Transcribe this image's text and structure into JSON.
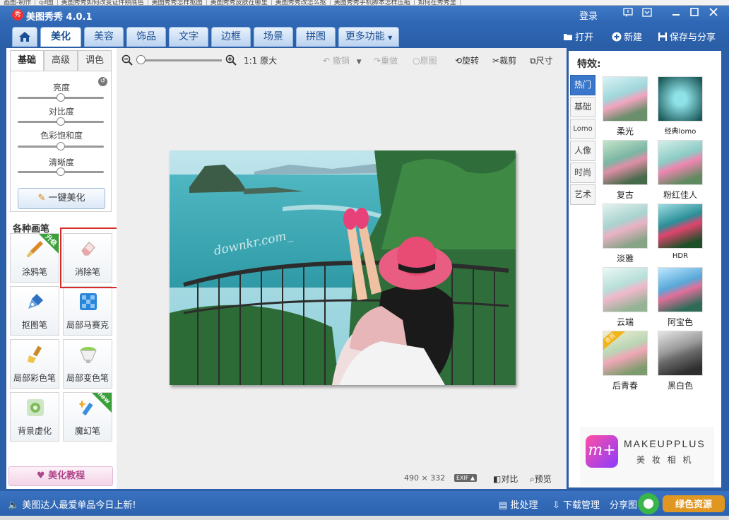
{
  "browser_tabs": [
    "画图-制作",
    "gif图",
    "美图秀秀如何改变证件照底色",
    "美图秀秀怎样抠图",
    "美图秀秀皮肤在哪里",
    "美图秀秀改怎么抠",
    "美图秀秀手机脚本怎样压缩",
    "如何在秀秀里"
  ],
  "app": {
    "title": "美图秀秀 4.0.1",
    "logo": "秀",
    "login": "登录"
  },
  "nav_tabs": [
    "美化",
    "美容",
    "饰品",
    "文字",
    "边框",
    "场景",
    "拼图",
    "更多功能"
  ],
  "actions": {
    "open": "打开",
    "new": "新建",
    "save_share": "保存与分享"
  },
  "left": {
    "subtabs": [
      "基础",
      "高级",
      "调色"
    ],
    "sliders": [
      {
        "label": "亮度",
        "value": 0.5
      },
      {
        "label": "对比度",
        "value": 0.5
      },
      {
        "label": "色彩饱和度",
        "value": 0.5
      },
      {
        "label": "清晰度",
        "value": 0.5
      }
    ],
    "one_click": "一键美化",
    "brushes_title": "各种画笔",
    "tools": [
      {
        "label": "涂鸦笔",
        "badge": "升级"
      },
      {
        "label": "消除笔"
      },
      {
        "label": "抠图笔"
      },
      {
        "label": "局部马赛克"
      },
      {
        "label": "局部彩色笔"
      },
      {
        "label": "局部变色笔"
      },
      {
        "label": "背景虚化"
      },
      {
        "label": "魔幻笔",
        "badge": "new"
      }
    ],
    "tutorial": "美化教程"
  },
  "toolbar": {
    "zoom_original": "1:1 原大",
    "undo": "撤销",
    "redo": "重做",
    "original": "原图",
    "rotate": "旋转",
    "crop": "裁剪",
    "size": "尺寸"
  },
  "canvas": {
    "watermark": "downkr.com_",
    "width_px": "490",
    "times": "×",
    "height_px": "332",
    "exif": "EXIF",
    "compare": "对比",
    "preview": "预览"
  },
  "right": {
    "title": "特效:",
    "categories": [
      "热门",
      "基础",
      "Lomo",
      "人像",
      "时尚",
      "艺术"
    ],
    "effects": [
      {
        "label": "柔光"
      },
      {
        "label": "经典lomo"
      },
      {
        "label": "复古"
      },
      {
        "label": "粉红佳人"
      },
      {
        "label": "淡雅"
      },
      {
        "label": "HDR"
      },
      {
        "label": "云端"
      },
      {
        "label": "阿宝色"
      },
      {
        "label": "后青春",
        "badge": "会员"
      },
      {
        "label": "黑白色"
      }
    ],
    "ad": {
      "brand": "MAKEUPPLUS",
      "subtitle": "美 妆 相 机",
      "logo": "m+"
    }
  },
  "status": {
    "news": "美图达人最爱单品今日上新!",
    "batch": "批处理",
    "downloads": "下载管理",
    "share": "分享图",
    "corner_logo": "绿色资源"
  }
}
